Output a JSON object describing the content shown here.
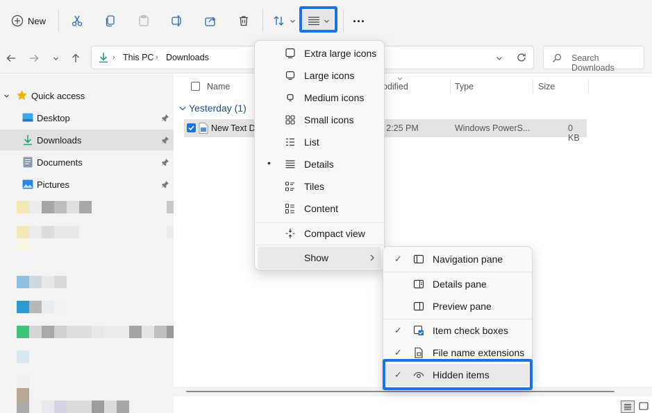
{
  "toolbar": {
    "new_label": "New",
    "more_label": "..."
  },
  "address": {
    "segments": [
      "This PC",
      "Downloads"
    ],
    "search_placeholder": "Search Downloads"
  },
  "sidebar": {
    "quick_access": "Quick access",
    "items": [
      {
        "label": "Desktop"
      },
      {
        "label": "Downloads"
      },
      {
        "label": "Documents"
      },
      {
        "label": "Pictures"
      }
    ]
  },
  "columns": {
    "name": "Name",
    "modified": "odified",
    "type": "Type",
    "size": "Size"
  },
  "group": {
    "label": "Yesterday (1)"
  },
  "file": {
    "name": "New Text Do",
    "modified": "l 2:25 PM",
    "type": "Windows PowerS...",
    "size": "0 KB"
  },
  "view_menu": {
    "items": [
      {
        "label": "Extra large icons",
        "icon": "monitor-large-icon"
      },
      {
        "label": "Large icons",
        "icon": "monitor-icon"
      },
      {
        "label": "Medium icons",
        "icon": "monitor-small-icon"
      },
      {
        "label": "Small icons",
        "icon": "grid-icon"
      },
      {
        "label": "List",
        "icon": "list-icon"
      },
      {
        "label": "Details",
        "icon": "details-icon",
        "selected_marker": "•"
      },
      {
        "label": "Tiles",
        "icon": "tiles-icon"
      },
      {
        "label": "Content",
        "icon": "content-icon"
      },
      {
        "label": "Compact view",
        "icon": "compact-icon"
      },
      {
        "label": "Show",
        "icon": "chevron-right-icon"
      }
    ]
  },
  "show_menu": {
    "items": [
      {
        "label": "Navigation pane",
        "checked": true,
        "check": "✓"
      },
      {
        "label": "Details pane",
        "checked": false
      },
      {
        "label": "Preview pane",
        "checked": false
      },
      {
        "label": "Item check boxes",
        "checked": true,
        "check": "✓"
      },
      {
        "label": "File name extensions",
        "checked": true,
        "check": "✓"
      },
      {
        "label": "Hidden items",
        "checked": true,
        "check": "✓"
      }
    ]
  },
  "colors": {
    "accent": "#1a73e8",
    "download_green": "#22a06b",
    "selection": "#e3e3e3"
  }
}
